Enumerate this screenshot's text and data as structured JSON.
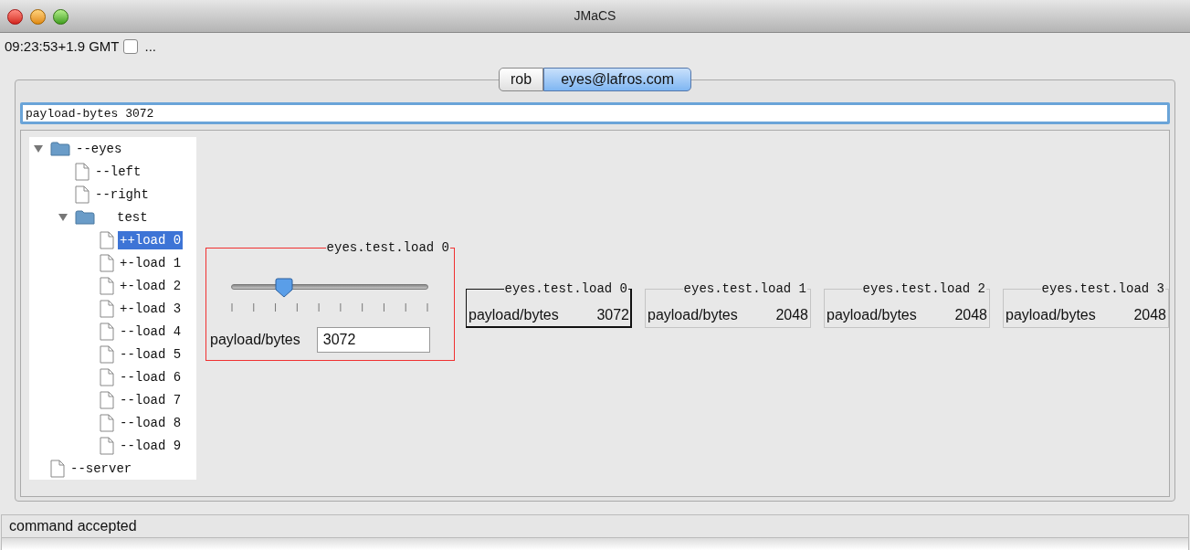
{
  "window": {
    "title": "JMaCS"
  },
  "clock": {
    "time": "09:23:53+1.9 GMT",
    "checked": false,
    "more": "..."
  },
  "tabs": [
    {
      "label": "rob",
      "selected": false
    },
    {
      "label": "eyes@lafros.com",
      "selected": true
    }
  ],
  "command": {
    "value": "payload-bytes 3072"
  },
  "tree": [
    {
      "label": "--eyes",
      "kind": "folder",
      "expanded": true,
      "selected": false,
      "children": [
        {
          "label": "--left",
          "kind": "leaf",
          "selected": false
        },
        {
          "label": "--right",
          "kind": "leaf",
          "selected": false
        },
        {
          "label": "test",
          "kind": "folder",
          "expanded": true,
          "selected": false,
          "children": [
            {
              "label": "++load 0",
              "kind": "leaf",
              "selected": true
            },
            {
              "label": "+-load 1",
              "kind": "leaf",
              "selected": false
            },
            {
              "label": "+-load 2",
              "kind": "leaf",
              "selected": false
            },
            {
              "label": "+-load 3",
              "kind": "leaf",
              "selected": false
            },
            {
              "label": "--load 4",
              "kind": "leaf",
              "selected": false
            },
            {
              "label": "--load 5",
              "kind": "leaf",
              "selected": false
            },
            {
              "label": "--load 6",
              "kind": "leaf",
              "selected": false
            },
            {
              "label": "--load 7",
              "kind": "leaf",
              "selected": false
            },
            {
              "label": "--load 8",
              "kind": "leaf",
              "selected": false
            },
            {
              "label": "--load 9",
              "kind": "leaf",
              "selected": false
            }
          ]
        }
      ]
    },
    {
      "label": "--server",
      "kind": "leaf",
      "selected": false
    }
  ],
  "control": {
    "title": "eyes.test.load 0",
    "level": 0.22,
    "field_label": "payload/bytes",
    "value": "3072"
  },
  "summaries": [
    {
      "title": "eyes.test.load 0",
      "label": "payload/bytes",
      "value": "3072",
      "selected": true
    },
    {
      "title": "eyes.test.load 1",
      "label": "payload/bytes",
      "value": "2048",
      "selected": false
    },
    {
      "title": "eyes.test.load 2",
      "label": "payload/bytes",
      "value": "2048",
      "selected": false
    },
    {
      "title": "eyes.test.load 3",
      "label": "payload/bytes",
      "value": "2048",
      "selected": false
    }
  ],
  "status_bar": "command accepted"
}
